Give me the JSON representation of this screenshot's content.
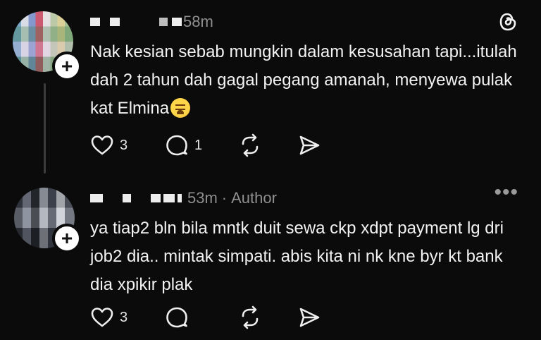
{
  "posts": [
    {
      "time": "58m",
      "text": "Nak kesian sebab mungkin dalam kesusahan tapi...itulah dah 2 tahun dah gagal pegang amanah, menyewa pulak kat Elmina",
      "emoji_icon": "tired-face-emoji",
      "likes": "3",
      "replies": "1"
    },
    {
      "time": "53m",
      "separator": "·",
      "author_label": "Author",
      "more_label": "•••",
      "text": "ya tiap2 bln bila mntk duit sewa ckp xdpt payment lg dri job2 dia.. mintak simpati. abis kita ni nk kne byr kt bank dia xpikir plak",
      "likes": "3"
    }
  ],
  "icons": {
    "app_logo": "threads-logo-icon",
    "follow": "plus-icon",
    "like": "heart-icon",
    "reply": "comment-icon",
    "repost": "repost-icon",
    "share": "send-icon"
  },
  "follow_label": "+"
}
